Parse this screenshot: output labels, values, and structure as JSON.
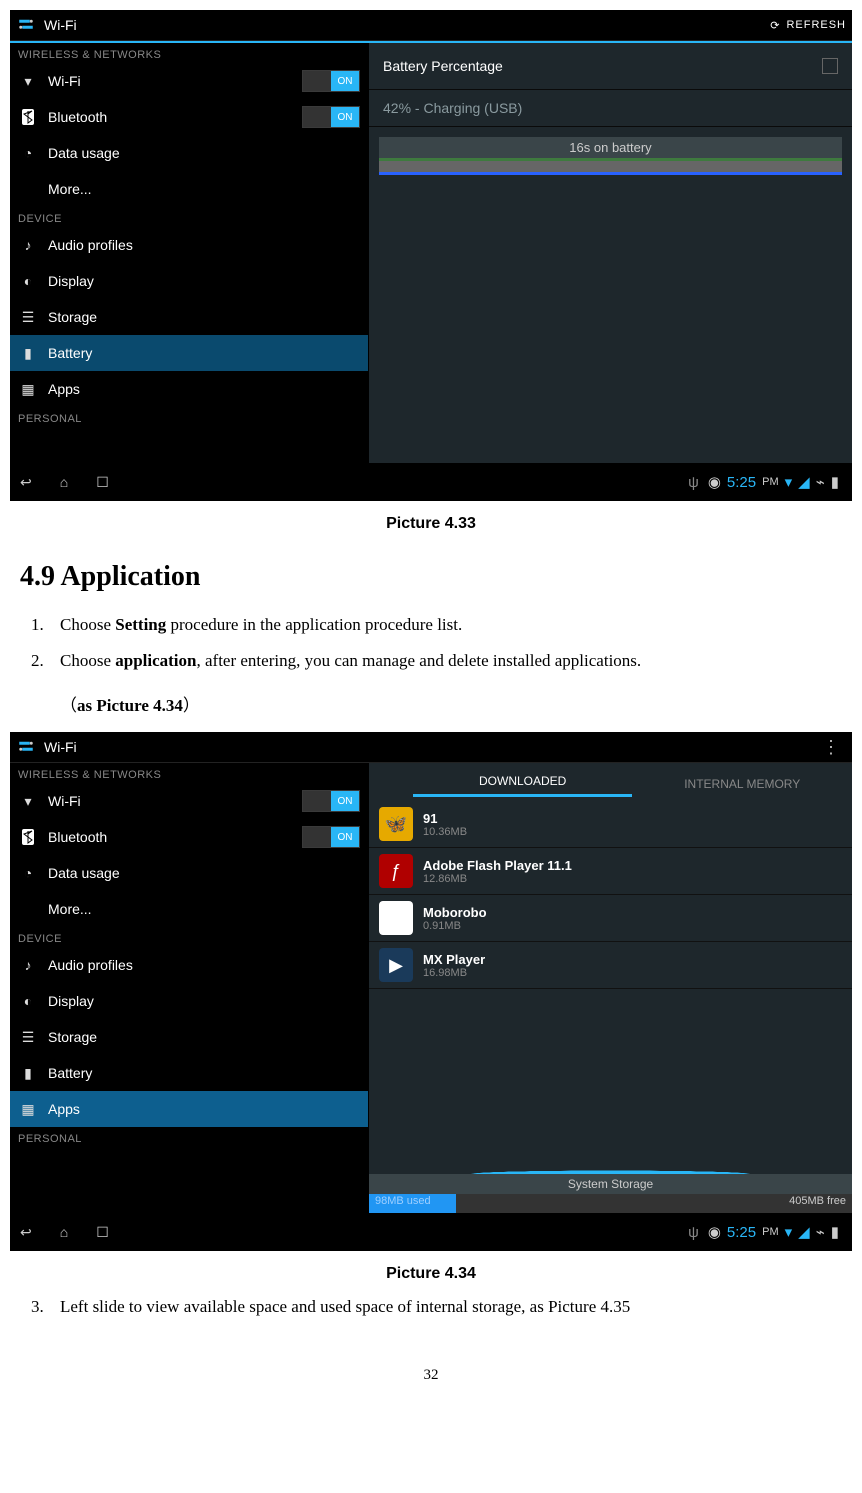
{
  "fig1": {
    "title": "Wi-Fi",
    "refresh": "REFRESH",
    "sections": {
      "wireless_hdr": "WIRELESS & NETWORKS",
      "device_hdr": "DEVICE",
      "personal_hdr": "PERSONAL"
    },
    "sidebar": {
      "wifi": "Wi-Fi",
      "bt": "Bluetooth",
      "data": "Data usage",
      "more": "More...",
      "audio": "Audio profiles",
      "display": "Display",
      "storage": "Storage",
      "battery": "Battery",
      "apps": "Apps"
    },
    "toggle_on": "ON",
    "panel": {
      "title": "Battery Percentage",
      "sub": "42% - Charging (USB)",
      "graph_label": "16s on battery"
    },
    "status_time": "5:25",
    "status_ampm": "PM"
  },
  "doc": {
    "caption1": "Picture 4.33",
    "h2": "4.9 Application",
    "li1_a": "Choose ",
    "li1_b": "Setting",
    "li1_c": " procedure in the application procedure list.",
    "li2_a": "Choose ",
    "li2_b": "application",
    "li2_c": ", after entering, you can manage and delete installed applications.",
    "li2_d": "（",
    "li2_e": "as Picture 4.34",
    "li2_f": "）",
    "caption2": "Picture 4.34",
    "li3": "Left slide to view available space and used space of internal storage, as Picture 4.35",
    "page": "32"
  },
  "fig2": {
    "title": "Wi-Fi",
    "tabs": {
      "downloaded": "DOWNLOADED",
      "internal": "INTERNAL MEMORY"
    },
    "apps": [
      {
        "name": "91",
        "size": "10.36MB",
        "bg": "#e6a900",
        "glyph": "🦋"
      },
      {
        "name": "Adobe Flash Player 11.1",
        "size": "12.86MB",
        "bg": "#b00000",
        "glyph": "ƒ"
      },
      {
        "name": "Moborobo",
        "size": "0.91MB",
        "bg": "#ffffff",
        "glyph": "〽"
      },
      {
        "name": "MX Player",
        "size": "16.98MB",
        "bg": "#1a3a5a",
        "glyph": "▶"
      }
    ],
    "storage": {
      "label": "System Storage",
      "used": "98MB used",
      "free": "405MB free"
    },
    "status_time": "5:25",
    "status_ampm": "PM"
  }
}
